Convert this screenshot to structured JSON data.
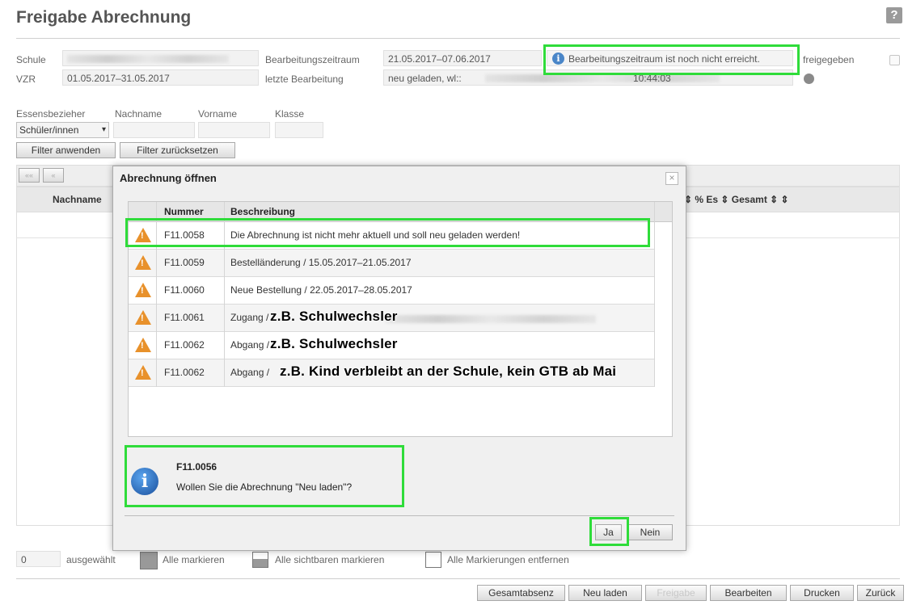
{
  "page": {
    "title": "Freigabe Abrechnung",
    "help_icon": "?"
  },
  "header": {
    "schule_label": "Schule",
    "vzr_label": "VZR",
    "vzr_value": "01.05.2017–31.05.2017",
    "bearbeitungszeitraum_label": "Bearbeitungszeitraum",
    "bearbeitungszeitraum_value": "21.05.2017–07.06.2017",
    "info_text": "Bearbeitungszeitraum ist noch nicht erreicht.",
    "letzte_bearbeitung_label": "letzte Bearbeitung",
    "letzte_bearbeitung_prefix": "neu geladen, wl::",
    "letzte_bearbeitung_time": "10:44:03",
    "freigegeben_label": "freigegeben"
  },
  "filters": {
    "essensbezieher_label": "Essensbezieher",
    "nachname_label": "Nachname",
    "vorname_label": "Vorname",
    "klasse_label": "Klasse",
    "essensbezieher_value": "Schüler/innen",
    "apply_button": "Filter anwenden",
    "reset_button": "Filter zurücksetzen"
  },
  "grid": {
    "nachname_header": "Nachname",
    "right_headers": "⇕ % Es ⇕ Gesamt ⇕ ⇕",
    "pager_first": "««",
    "pager_prev": "«"
  },
  "dialog": {
    "title": "Abrechnung öffnen",
    "close": "×",
    "columns": {
      "nummer": "Nummer",
      "beschreibung": "Beschreibung"
    },
    "rows": [
      {
        "nummer": "F11.0058",
        "beschreibung": "Die Abrechnung ist nicht mehr aktuell und soll neu geladen werden!"
      },
      {
        "nummer": "F11.0059",
        "beschreibung": "Bestelländerung / 15.05.2017–21.05.2017"
      },
      {
        "nummer": "F11.0060",
        "beschreibung": "Neue Bestellung / 22.05.2017–28.05.2017"
      },
      {
        "nummer": "F11.0061",
        "beschreibung": "Zugang /",
        "overlay": "z.B. Schulwechsler"
      },
      {
        "nummer": "F11.0062",
        "beschreibung": "Abgang /",
        "overlay": "z.B. Schulwechsler"
      },
      {
        "nummer": "F11.0062",
        "beschreibung": "Abgang /",
        "overlay": "z.B. Kind verbleibt an der Schule, kein GTB ab Mai"
      }
    ],
    "message_code": "F11.0056",
    "message_text": "Wollen Sie die Abrechnung \"Neu laden\"?",
    "yes_button": "Ja",
    "no_button": "Nein"
  },
  "selection": {
    "count": "0",
    "selected_label": "ausgewählt",
    "mark_all": "Alle markieren",
    "mark_visible": "Alle sichtbaren markieren",
    "unmark_all": "Alle Markierungen entfernen"
  },
  "footer": {
    "gesamtabsenz": "Gesamtabsenz",
    "neu_laden": "Neu laden",
    "freigabe": "Freigabe",
    "bearbeiten": "Bearbeiten",
    "drucken": "Drucken",
    "zurueck": "Zurück"
  },
  "colors": {
    "highlight": "#2fdc3a",
    "warning": "#e8912b",
    "info": "#4a86c8"
  }
}
